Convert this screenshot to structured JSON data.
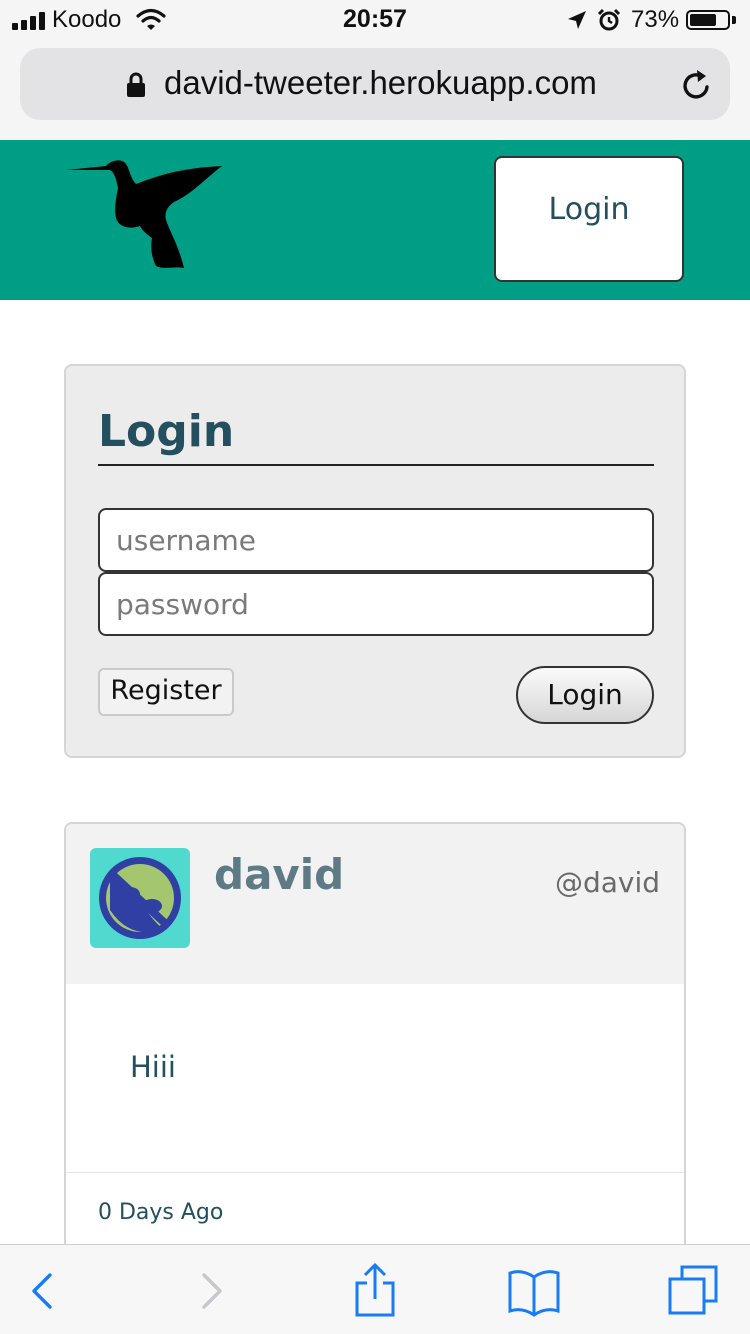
{
  "status_bar": {
    "carrier": "Koodo",
    "time": "20:57",
    "battery_percent": "73%",
    "battery_level": 0.73,
    "icons": [
      "signal-icon",
      "wifi-icon",
      "location-arrow-icon",
      "alarm-icon",
      "battery-icon"
    ]
  },
  "browser": {
    "url": "david-tweeter.herokuapp.com",
    "icons": [
      "lock-icon",
      "reload-icon"
    ],
    "toolbar": {
      "icons": [
        "back-icon",
        "forward-icon",
        "share-icon",
        "bookmarks-icon",
        "tabs-icon"
      ]
    }
  },
  "header": {
    "logo_icon": "hummingbird-logo-icon",
    "login_label": "Login",
    "background_color": "#009e85"
  },
  "login_form": {
    "title": "Login",
    "username_placeholder": "username",
    "password_placeholder": "password",
    "register_label": "Register",
    "login_label": "Login"
  },
  "tweet": {
    "name": "david",
    "handle": "@david",
    "text": "Hiii",
    "time": "0 Days Ago",
    "avatar_icon": "sunglasses-avatar-icon"
  },
  "colors": {
    "accent": "#009e85",
    "heading": "#234f5e",
    "tweet_name": "#5e7a85",
    "avatar_bg": "#4fd9cf",
    "ios_blue": "#1a7cf5"
  }
}
